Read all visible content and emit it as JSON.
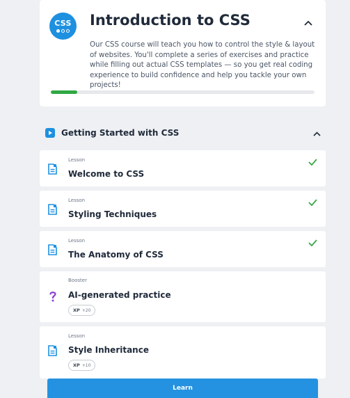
{
  "course": {
    "icon_label": "CSS",
    "title": "Introduction to CSS",
    "description": "Our CSS course will teach you how to control the style & layout of websites. You'll complete a series of exercises and practice while filling out actual CSS templates — so you get real coding experience to build confidence and help you tackle your own projects!",
    "progress": 0.1
  },
  "section": {
    "title": "Getting Started with CSS"
  },
  "lessons": [
    {
      "type": "Lesson",
      "title": "Welcome to CSS",
      "completed": true,
      "icon": "document-icon"
    },
    {
      "type": "Lesson",
      "title": "Styling Techniques",
      "completed": true,
      "icon": "document-icon"
    },
    {
      "type": "Lesson",
      "title": "The Anatomy of CSS",
      "completed": true,
      "icon": "document-icon"
    },
    {
      "type": "Booster",
      "title": "AI-generated practice",
      "completed": false,
      "icon": "question-mark-icon",
      "xp_label": "XP",
      "xp_value": "+20"
    },
    {
      "type": "Lesson",
      "title": "Style Inheritance",
      "completed": false,
      "icon": "document-icon",
      "xp_label": "XP",
      "xp_value": "+10"
    }
  ],
  "learn_button": {
    "label": "Learn"
  },
  "colors": {
    "accent": "#1e90e0",
    "progress": "#2fa843",
    "check": "#3aa84a",
    "booster": "#8a3fd1",
    "background": "#eef0f3"
  }
}
